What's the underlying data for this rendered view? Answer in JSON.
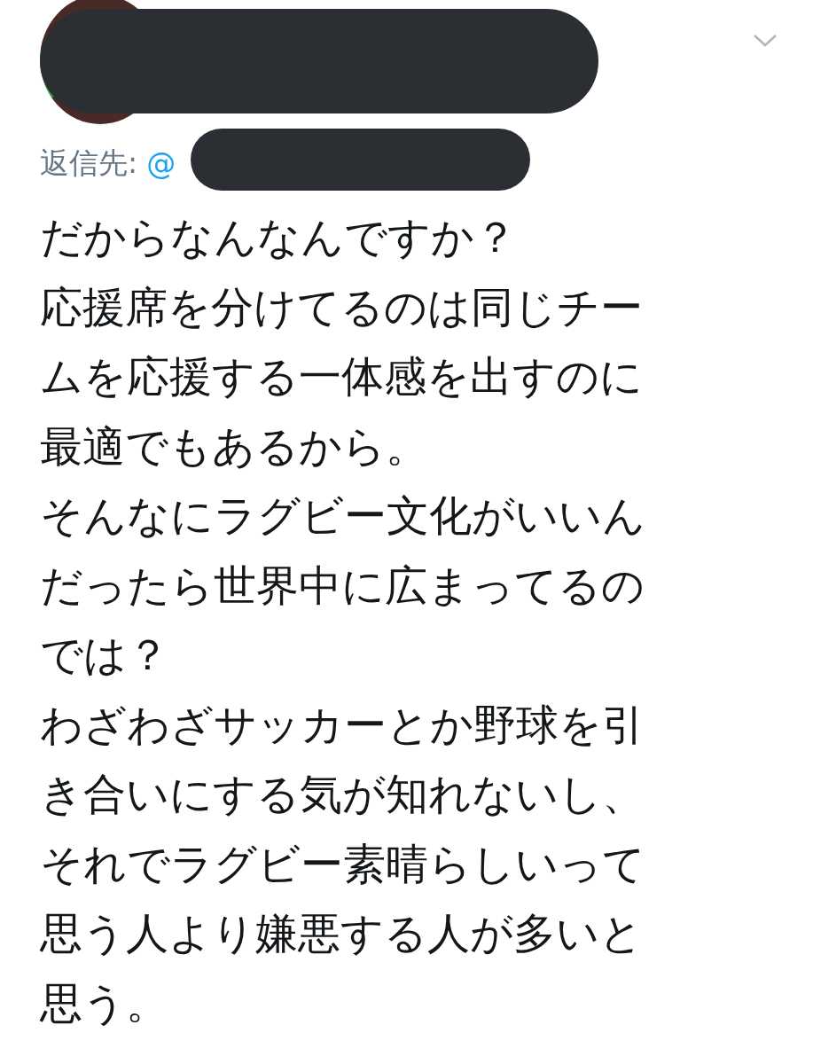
{
  "reply": {
    "label": "返信先:",
    "handle": "@"
  },
  "body_lines": [
    "だからなんなんですか？",
    "応援席を分けてるのは同じチー",
    "ムを応援する一体感を出すのに",
    "最適でもあるから。",
    "そんなにラグビー文化がいいん",
    "だったら世界中に広まってるの",
    "では？",
    "わざわざサッカーとか野球を引",
    "き合いにする気が知れないし、",
    "それでラグビー素晴らしいって",
    "思う人より嫌悪する人が多いと",
    "思う。"
  ]
}
